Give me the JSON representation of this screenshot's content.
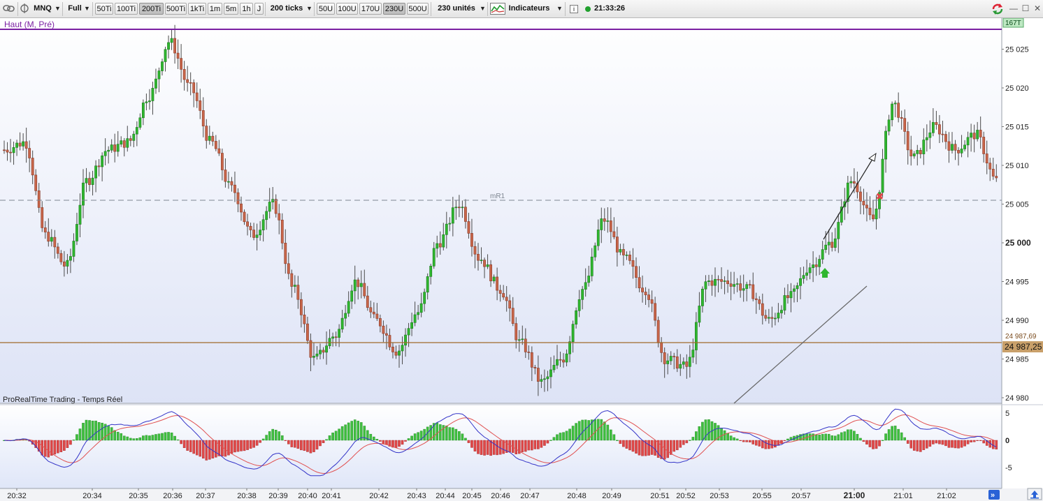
{
  "toolbar": {
    "symbol": "MNQ",
    "range": "Full",
    "tick_buttons": [
      {
        "label": "50Ti",
        "active": false
      },
      {
        "label": "100Ti",
        "active": false
      },
      {
        "label": "200Ti",
        "active": true
      },
      {
        "label": "500Ti",
        "active": false
      },
      {
        "label": "1kTi",
        "active": false
      },
      {
        "label": "1m",
        "active": false
      },
      {
        "label": "5m",
        "active": false
      },
      {
        "label": "1h",
        "active": false
      },
      {
        "label": "J",
        "active": false
      }
    ],
    "ticks_select": "200 ticks",
    "unit_buttons": [
      {
        "label": "50U",
        "active": false
      },
      {
        "label": "100U",
        "active": false
      },
      {
        "label": "170U",
        "active": false
      },
      {
        "label": "230U",
        "active": true
      },
      {
        "label": "500U",
        "active": false
      }
    ],
    "units_select": "230 unités",
    "indicators_label": "Indicateurs",
    "info_icon": "i",
    "time": "21:33:26"
  },
  "chart": {
    "top_label": "Haut (M, Pré)",
    "badge": "167T",
    "watermark": "ProRealTime Trading - Temps Réel",
    "level_marker": "mR1",
    "price_box": "24 987,25",
    "price_box_under": "24 987,69",
    "price_ticks": [
      "25 025",
      "25 020",
      "25 015",
      "25 010",
      "25 005",
      "25 000",
      "24 995",
      "24 990",
      "24 985",
      "24 980"
    ],
    "osc_ticks": [
      "5",
      "0",
      "-5"
    ],
    "time_labels": [
      "20:32",
      "20:34",
      "20:35",
      "20:36",
      "20:37",
      "20:38",
      "20:39",
      "20:40",
      "20:41",
      "20:42",
      "20:43",
      "20:44",
      "20:45",
      "20:46",
      "20:47",
      "20:48",
      "20:49",
      "20:51",
      "20:52",
      "20:53",
      "20:55",
      "20:57",
      "21:00",
      "21:01",
      "21:02"
    ],
    "bold_time": "21:00",
    "colors": {
      "up": "#2fb72f",
      "down": "#c8664a",
      "macd": "#3434c8",
      "signal": "#e05050",
      "hist_up": "#3fbf3f",
      "hist_down": "#e04848",
      "top_line": "#7a1fa2",
      "support": "#a06a2a"
    }
  },
  "chart_data": {
    "type": "candlestick",
    "price_axis": {
      "min": 24980,
      "max": 25027,
      "step": 5
    },
    "anchor_prices": [
      25012,
      25013,
      25001,
      24997,
      25008,
      25012,
      25013,
      25019,
      25026,
      25020,
      25013,
      25007,
      25001,
      25005,
      24994,
      24985,
      24988,
      24995,
      24990,
      24986,
      24991,
      25000,
      25005,
      24998,
      24994,
      24987,
      24982,
      24985,
      24994,
      25003,
      24998,
      24994,
      24985,
      24984,
      24995,
      24995,
      24994,
      24990,
      24993,
      24997,
      25000,
      25008,
      25003,
      25018,
      25011,
      25015,
      25012,
      25014,
      25008
    ],
    "oscillator": {
      "min": -6.5,
      "max": 6
    }
  }
}
